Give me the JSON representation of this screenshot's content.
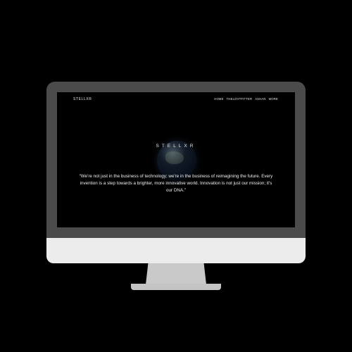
{
  "site": {
    "logo": "STELLXR",
    "wordmark": "STELLXR"
  },
  "nav": {
    "items": [
      {
        "label": "HOME"
      },
      {
        "label": "THELOVTFITTER"
      },
      {
        "label": "ASHAN"
      },
      {
        "label": "MORE"
      }
    ]
  },
  "hero": {
    "quote": "“We're not just in the business of technology; we're in the business of reimagining the future. Every invention is a step towards a brighter, more innovative world. Innovation is not just our mission; it's our DNA.”"
  },
  "colors": {
    "background": "#000000",
    "bezel": "#4a4b4a",
    "chin": "#ececec",
    "stand": "#c9c9c9",
    "text": "#f0f0f0"
  },
  "icons": {
    "hero_image": "earth-globe-icon"
  }
}
